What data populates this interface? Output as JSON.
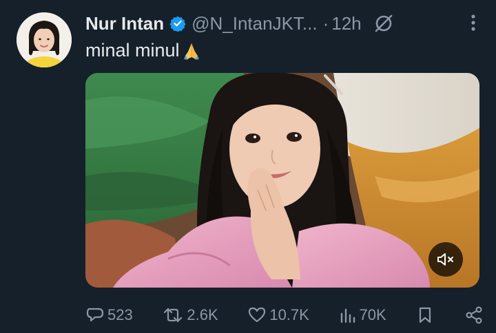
{
  "tweet": {
    "author_name": "Nur Intan",
    "handle": "@N_IntanJKT...",
    "separator": "·",
    "time": "12h",
    "text": "minal minul",
    "emoji_icon": "folded-hands-icon"
  },
  "actions": {
    "replies": "523",
    "retweets": "2.6K",
    "likes": "10.7K",
    "views": "70K"
  },
  "colors": {
    "background": "#15202b",
    "text_primary": "#e7e9ea",
    "text_secondary": "#8b98a5",
    "verified": "#1d9bf0"
  }
}
